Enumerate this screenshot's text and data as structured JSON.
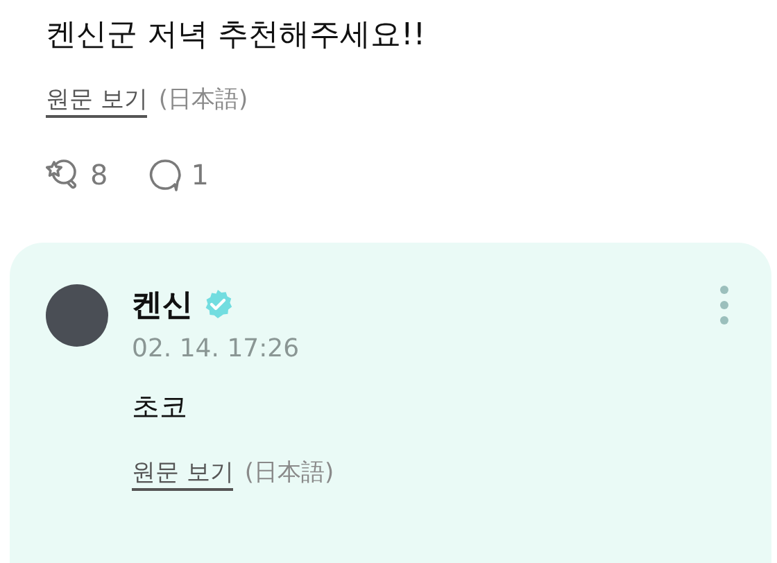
{
  "post": {
    "title": "켄신군 저녁 추천해주세요!!",
    "translate_link": "원문 보기",
    "language": "(日本語)",
    "likes": "8",
    "comments": "1"
  },
  "reply": {
    "author": "켄신",
    "verified": true,
    "time": "02. 14. 17:26",
    "text": "초코",
    "translate_link": "원문 보기",
    "language": "(日本語)"
  }
}
